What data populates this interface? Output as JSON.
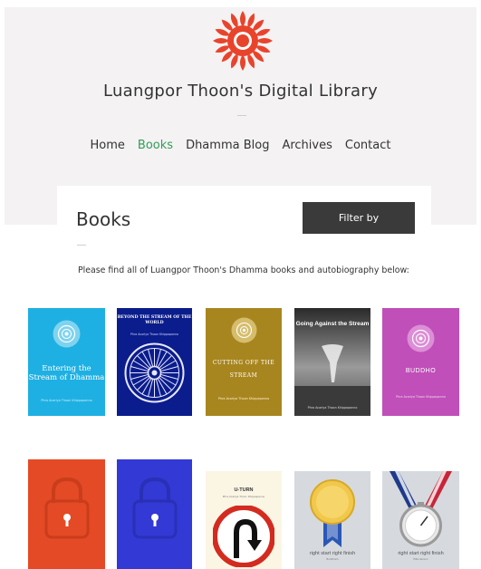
{
  "site": {
    "title": "Luangpor Thoon's Digital Library"
  },
  "nav": {
    "items": [
      "Home",
      "Books",
      "Dhamma Blog",
      "Archives",
      "Contact"
    ],
    "active": "Books"
  },
  "page": {
    "title": "Books",
    "filter_label": "Filter by",
    "intro": "Please find all of Luangpor Thoon's Dhamma books and autobiography below:"
  },
  "books": [
    {
      "title": "Entering the Stream of Dhamma",
      "author": "Phra Acariya Thoon Khippapanno",
      "icon": "lotus-icon",
      "color": "#1eb0e2"
    },
    {
      "title": "BEYOND THE STREAM OF THE WORLD",
      "author": "Phra Acariya Thoon Khippapanno",
      "icon": "dhamma-wheel-icon",
      "color": "#0b1d8c"
    },
    {
      "title": "CUTTING OFF THE STREAM",
      "author": "Phra Acariya Thoon Khippapanno",
      "icon": "lotus-icon",
      "color": "#a8861f"
    },
    {
      "title": "Going Against the Stream",
      "author": "Phra Acariya Thoon Khippapanno",
      "icon": "tornado-icon",
      "color": "#3d3d3d"
    },
    {
      "title": "BUDDHO",
      "author": "Phra Acariya Thoon Khippapanno",
      "icon": "lotus-icon",
      "color": "#c04fb9"
    },
    {
      "title": "",
      "author": "",
      "icon": "padlock-icon",
      "color": "#e44a25"
    },
    {
      "title": "",
      "author": "",
      "icon": "padlock-icon",
      "color": "#3339d4"
    },
    {
      "title": "U-TURN",
      "author": "Phra Acariya Thoon Khippapanno",
      "icon": "u-turn-sign-icon",
      "color": "#fbf5e4"
    },
    {
      "title": "right start right finish",
      "author": "Buddhism",
      "icon": "medal-icon",
      "color": "#d6d9de"
    },
    {
      "title": "right start right finish",
      "author": "Elite Version",
      "icon": "stopwatch-medal-icon",
      "color": "#d6d9de"
    }
  ],
  "colors": {
    "accent": "#2f9e56",
    "logo": "#e8442c",
    "button": "#3a3a3a",
    "header_bg": "#f4f2f3"
  }
}
